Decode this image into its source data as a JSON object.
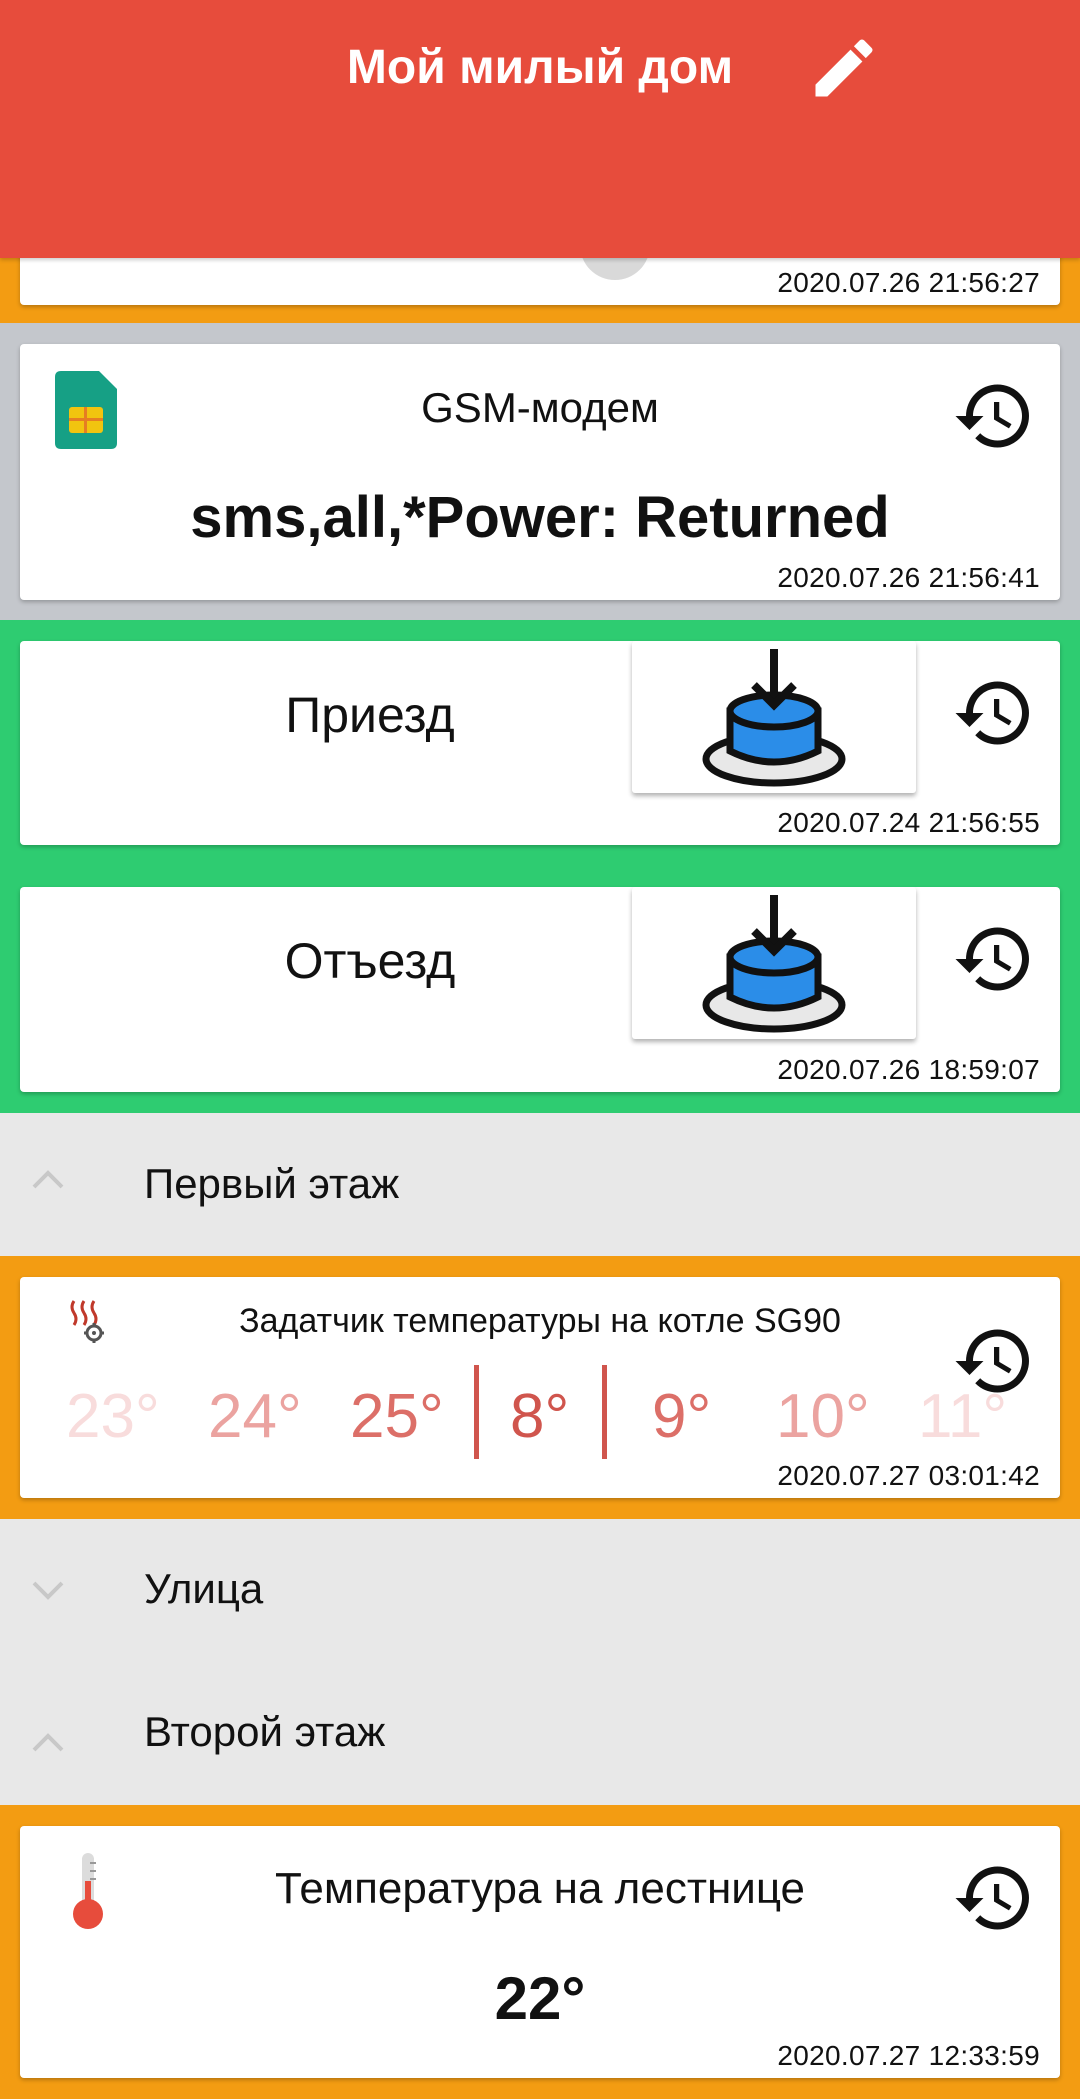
{
  "header": {
    "title": "Мой милый дом",
    "bg_color": "#e74c3c",
    "edit_icon": "pencil-icon"
  },
  "top_partial": {
    "timestamp": "2020.07.26 21:56:27",
    "border_color": "#f39c12"
  },
  "gsm": {
    "title": "GSM-модем",
    "value": "sms,all,*Power: Returned",
    "timestamp": "2020.07.26 21:56:41",
    "icon": "sim-card-icon",
    "border_color": "#c4c7cc"
  },
  "arrival": {
    "label": "Приезд",
    "timestamp": "2020.07.24 21:56:55",
    "icon": "save-download-icon"
  },
  "departure": {
    "label": "Отъезд",
    "timestamp": "2020.07.26 18:59:07",
    "icon": "save-download-icon"
  },
  "group_color_green": "#2ecc71",
  "group_color_orange": "#f39c12",
  "sections": {
    "first_floor": "Первый этаж",
    "street": "Улица",
    "second_floor": "Второй этаж"
  },
  "boiler": {
    "title": "Задатчик температуры на котле SG90",
    "left_values": [
      "23°",
      "24°",
      "25°"
    ],
    "selected": "8°",
    "right_values": [
      "9°",
      "10°",
      "11°"
    ],
    "timestamp": "2020.07.27 03:01:42",
    "icon": "heating-gear-icon"
  },
  "stairs": {
    "title": "Температура на лестнице",
    "value": "22°",
    "timestamp": "2020.07.27 12:33:59",
    "icon": "thermometer-icon"
  }
}
